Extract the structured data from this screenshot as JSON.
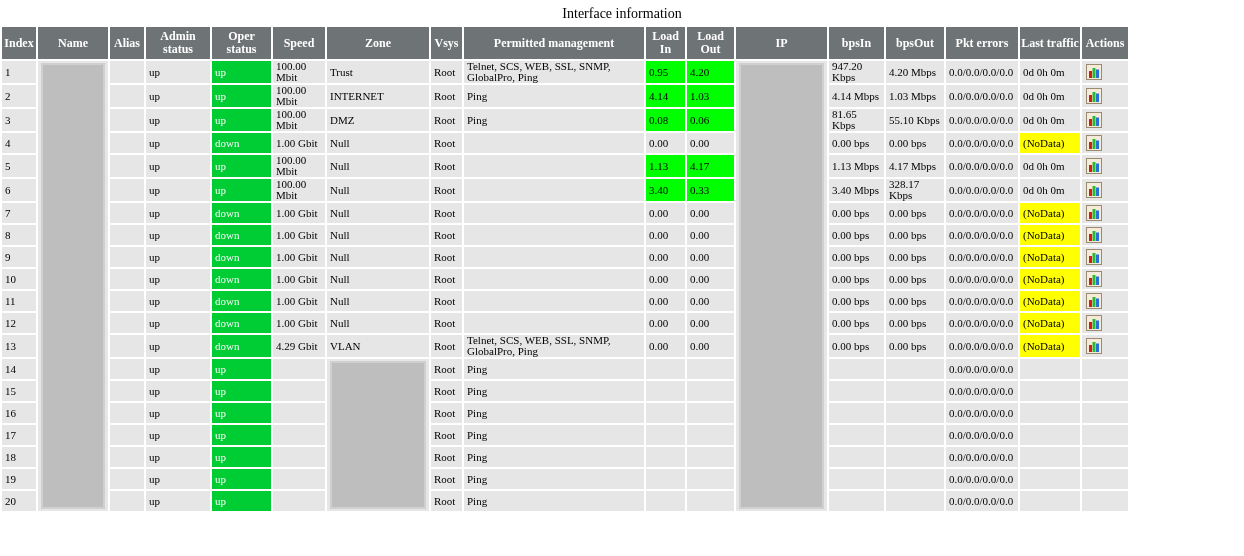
{
  "title": "Interface information",
  "columns": [
    "Index",
    "Name",
    "Alias",
    "Admin status",
    "Oper status",
    "Speed",
    "Zone",
    "Vsys",
    "Permitted management",
    "Load In",
    "Load Out",
    "IP",
    "bpsIn",
    "bpsOut",
    "Pkt errors",
    "Last traffic",
    "Actions"
  ],
  "rows": [
    {
      "index": "1",
      "admin": "up",
      "oper": "up",
      "speed": "100.00 Mbit",
      "zone": "Trust",
      "vsys": "Root",
      "permitted": "Telnet, SCS, WEB, SSL, SNMP, GlobalPro, Ping",
      "load_in": "0.95",
      "load_out": "4.20",
      "load_high": true,
      "bps_in": "947.20 Kbps",
      "bps_out": "4.20 Mbps",
      "pkt_errors": "0.0/0.0/0.0/0.0",
      "last_traffic": "0d 0h 0m",
      "no_data": false,
      "chart_action": true
    },
    {
      "index": "2",
      "admin": "up",
      "oper": "up",
      "speed": "100.00 Mbit",
      "zone": "INTERNET",
      "vsys": "Root",
      "permitted": "Ping",
      "load_in": "4.14",
      "load_out": "1.03",
      "load_high": true,
      "bps_in": "4.14 Mbps",
      "bps_out": "1.03 Mbps",
      "pkt_errors": "0.0/0.0/0.0/0.0",
      "last_traffic": "0d 0h 0m",
      "no_data": false,
      "chart_action": true
    },
    {
      "index": "3",
      "admin": "up",
      "oper": "up",
      "speed": "100.00 Mbit",
      "zone": "DMZ",
      "vsys": "Root",
      "permitted": "Ping",
      "load_in": "0.08",
      "load_out": "0.06",
      "load_high": true,
      "bps_in": "81.65 Kbps",
      "bps_out": "55.10 Kbps",
      "pkt_errors": "0.0/0.0/0.0/0.0",
      "last_traffic": "0d 0h 0m",
      "no_data": false,
      "chart_action": true
    },
    {
      "index": "4",
      "admin": "up",
      "oper": "down",
      "speed": "1.00 Gbit",
      "zone": "Null",
      "vsys": "Root",
      "load_in": "0.00",
      "load_out": "0.00",
      "load_high": false,
      "bps_in": "0.00 bps",
      "bps_out": "0.00 bps",
      "pkt_errors": "0.0/0.0/0.0/0.0",
      "last_traffic": "(NoData)",
      "no_data": true,
      "chart_action": true
    },
    {
      "index": "5",
      "admin": "up",
      "oper": "up",
      "speed": "100.00 Mbit",
      "zone": "Null",
      "vsys": "Root",
      "load_in": "1.13",
      "load_out": "4.17",
      "load_high": true,
      "bps_in": "1.13 Mbps",
      "bps_out": "4.17 Mbps",
      "pkt_errors": "0.0/0.0/0.0/0.0",
      "last_traffic": "0d 0h 0m",
      "no_data": false,
      "chart_action": true
    },
    {
      "index": "6",
      "admin": "up",
      "oper": "up",
      "speed": "100.00 Mbit",
      "zone": "Null",
      "vsys": "Root",
      "load_in": "3.40",
      "load_out": "0.33",
      "load_high": true,
      "bps_in": "3.40 Mbps",
      "bps_out": "328.17 Kbps",
      "pkt_errors": "0.0/0.0/0.0/0.0",
      "last_traffic": "0d 0h 0m",
      "no_data": false,
      "chart_action": true
    },
    {
      "index": "7",
      "admin": "up",
      "oper": "down",
      "speed": "1.00 Gbit",
      "zone": "Null",
      "vsys": "Root",
      "load_in": "0.00",
      "load_out": "0.00",
      "load_high": false,
      "bps_in": "0.00 bps",
      "bps_out": "0.00 bps",
      "pkt_errors": "0.0/0.0/0.0/0.0",
      "last_traffic": "(NoData)",
      "no_data": true,
      "chart_action": true
    },
    {
      "index": "8",
      "admin": "up",
      "oper": "down",
      "speed": "1.00 Gbit",
      "zone": "Null",
      "vsys": "Root",
      "load_in": "0.00",
      "load_out": "0.00",
      "load_high": false,
      "bps_in": "0.00 bps",
      "bps_out": "0.00 bps",
      "pkt_errors": "0.0/0.0/0.0/0.0",
      "last_traffic": "(NoData)",
      "no_data": true,
      "chart_action": true
    },
    {
      "index": "9",
      "admin": "up",
      "oper": "down",
      "speed": "1.00 Gbit",
      "zone": "Null",
      "vsys": "Root",
      "load_in": "0.00",
      "load_out": "0.00",
      "load_high": false,
      "bps_in": "0.00 bps",
      "bps_out": "0.00 bps",
      "pkt_errors": "0.0/0.0/0.0/0.0",
      "last_traffic": "(NoData)",
      "no_data": true,
      "chart_action": true
    },
    {
      "index": "10",
      "admin": "up",
      "oper": "down",
      "speed": "1.00 Gbit",
      "zone": "Null",
      "vsys": "Root",
      "load_in": "0.00",
      "load_out": "0.00",
      "load_high": false,
      "bps_in": "0.00 bps",
      "bps_out": "0.00 bps",
      "pkt_errors": "0.0/0.0/0.0/0.0",
      "last_traffic": "(NoData)",
      "no_data": true,
      "chart_action": true
    },
    {
      "index": "11",
      "admin": "up",
      "oper": "down",
      "speed": "1.00 Gbit",
      "zone": "Null",
      "vsys": "Root",
      "load_in": "0.00",
      "load_out": "0.00",
      "load_high": false,
      "bps_in": "0.00 bps",
      "bps_out": "0.00 bps",
      "pkt_errors": "0.0/0.0/0.0/0.0",
      "last_traffic": "(NoData)",
      "no_data": true,
      "chart_action": true
    },
    {
      "index": "12",
      "admin": "up",
      "oper": "down",
      "speed": "1.00 Gbit",
      "zone": "Null",
      "vsys": "Root",
      "load_in": "0.00",
      "load_out": "0.00",
      "load_high": false,
      "bps_in": "0.00 bps",
      "bps_out": "0.00 bps",
      "pkt_errors": "0.0/0.0/0.0/0.0",
      "last_traffic": "(NoData)",
      "no_data": true,
      "chart_action": true
    },
    {
      "index": "13",
      "admin": "up",
      "oper": "down",
      "speed": "4.29 Gbit",
      "zone": "VLAN",
      "vsys": "Root",
      "permitted": "Telnet, SCS, WEB, SSL, SNMP, GlobalPro, Ping",
      "load_in": "0.00",
      "load_out": "0.00",
      "load_high": false,
      "bps_in": "0.00 bps",
      "bps_out": "0.00 bps",
      "pkt_errors": "0.0/0.0/0.0/0.0",
      "last_traffic": "(NoData)",
      "no_data": true,
      "chart_action": true
    },
    {
      "index": "14",
      "admin": "up",
      "oper": "up",
      "vsys": "Root",
      "permitted": "Ping",
      "pkt_errors": "0.0/0.0/0.0/0.0"
    },
    {
      "index": "15",
      "admin": "up",
      "oper": "up",
      "vsys": "Root",
      "permitted": "Ping",
      "pkt_errors": "0.0/0.0/0.0/0.0"
    },
    {
      "index": "16",
      "admin": "up",
      "oper": "up",
      "vsys": "Root",
      "permitted": "Ping",
      "pkt_errors": "0.0/0.0/0.0/0.0"
    },
    {
      "index": "17",
      "admin": "up",
      "oper": "up",
      "vsys": "Root",
      "permitted": "Ping",
      "pkt_errors": "0.0/0.0/0.0/0.0"
    },
    {
      "index": "18",
      "admin": "up",
      "oper": "up",
      "vsys": "Root",
      "permitted": "Ping",
      "pkt_errors": "0.0/0.0/0.0/0.0"
    },
    {
      "index": "19",
      "admin": "up",
      "oper": "up",
      "vsys": "Root",
      "permitted": "Ping",
      "pkt_errors": "0.0/0.0/0.0/0.0"
    },
    {
      "index": "20",
      "admin": "up",
      "oper": "up",
      "vsys": "Root",
      "permitted": "Ping",
      "pkt_errors": "0.0/0.0/0.0/0.0"
    }
  ]
}
